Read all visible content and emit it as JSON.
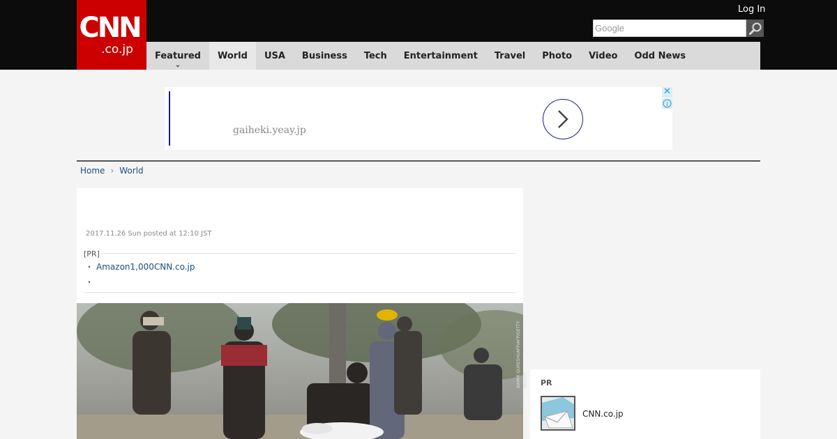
{
  "header": {
    "logo_main": "CNN",
    "logo_sub": ".co.jp",
    "login_label": "Log In",
    "search_placeholder": "Google"
  },
  "nav": {
    "items": [
      {
        "label": "Featured"
      },
      {
        "label": "World"
      },
      {
        "label": "USA"
      },
      {
        "label": "Business"
      },
      {
        "label": "Tech"
      },
      {
        "label": "Entertainment"
      },
      {
        "label": "Travel"
      },
      {
        "label": "Photo"
      },
      {
        "label": "Video"
      },
      {
        "label": "Odd News"
      }
    ],
    "active": "World",
    "dropdown_chevron": "⌄"
  },
  "ad": {
    "domain": "gaiheki.yeay.jp",
    "close": "✕",
    "info": "i"
  },
  "breadcrumb": {
    "home": "Home",
    "separator": "›",
    "section": "World"
  },
  "article": {
    "date": "2017.11.26 Sun posted at 12:10 JST",
    "pr_label": "[PR]",
    "pr_links": [
      {
        "bullet": "・",
        "text": "Amazon1,000CNN.co.jp"
      },
      {
        "bullet": "・",
        "text": ""
      }
    ],
    "photo_credit": "AAMIR QURESHI/AFP/AFP/GETTY IMAGES"
  },
  "sidebar_pr": {
    "label": "PR",
    "item_title": "CNN.co.jp"
  },
  "colors": {
    "brand_red": "#cc0000",
    "header_bg": "#0c0c0c",
    "nav_bg": "#dadada",
    "link": "#1a4f7a"
  }
}
